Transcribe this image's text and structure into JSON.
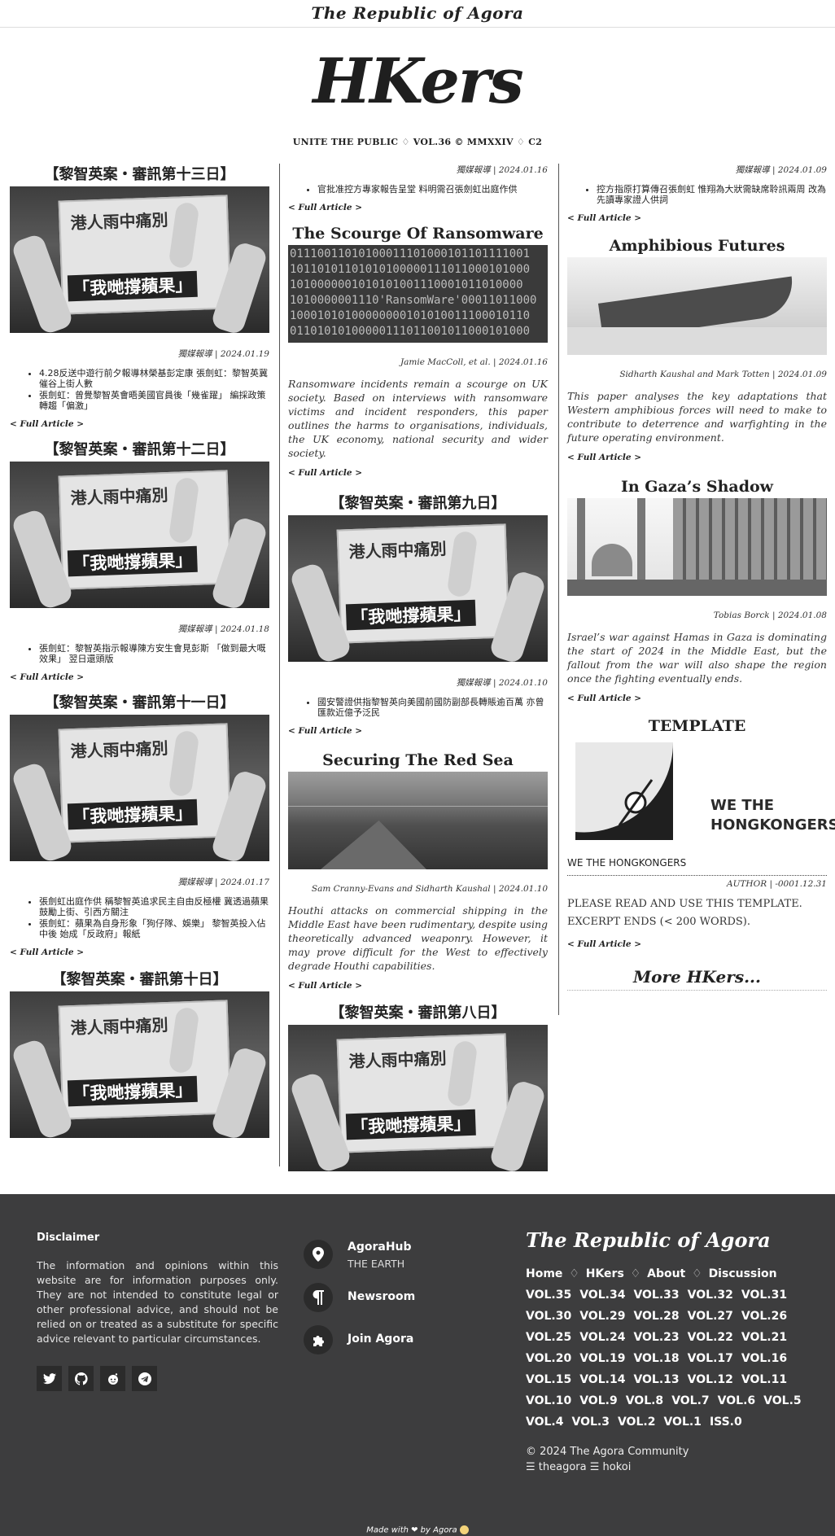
{
  "topbar": {
    "brand": "The Republic of Agora"
  },
  "masthead": {
    "logo": "HKers",
    "tagline": "UNITE THE PUBLIC ♢ VOL.36 © MMXXIV ♢ C2"
  },
  "full_article": "< Full Article >",
  "photo_text": {
    "headline": "港人雨中痛別",
    "slogan": "「我哋撐蘋果」"
  },
  "left": [
    {
      "title": "【黎智英案・審訊第十三日】",
      "byline": "獨媒報導 | 2024.01.19",
      "bullets": [
        "4.28反送中遊行前夕報導林榮基彭定康 張劍虹：黎智英冀催谷上街人數",
        "張劍虹：曾覺黎智英會晤美國官員後「幾雀躍」 編採政策轉趨「偏激」"
      ]
    },
    {
      "title": "【黎智英案・審訊第十二日】",
      "byline": "獨媒報導 | 2024.01.18",
      "bullets": [
        "張劍虹：黎智英指示報導陳方安生會見彭斯 「做到最大嘅效果」 翌日還頭版"
      ]
    },
    {
      "title": "【黎智英案・審訊第十一日】",
      "byline": "獨媒報導 | 2024.01.17",
      "bullets": [
        "張劍虹出庭作供 稱黎智英追求民主自由反極權 冀透過蘋果鼓勵上街、引西方關注",
        "張劍虹：蘋果為自身形象「狗仔隊、娛樂」 黎智英投入佔中後 始成「反政府」報紙"
      ]
    },
    {
      "title": "【黎智英案・審訊第十日】"
    }
  ],
  "mid": {
    "top": {
      "byline": "獨媒報導 | 2024.01.16",
      "bullets": [
        "官批准控方專家報告呈堂 料明需召張劍虹出庭作供"
      ]
    },
    "ransom": {
      "title": "The Scourge Of Ransomware",
      "byline": "Jamie MacColl, et al. | 2024.01.16",
      "abstract": "Ransomware incidents remain a scourge on UK society. Based on interviews with ransomware victims and incident responders, this paper outlines the harms to organisations, individuals, the UK economy, national security and wider society.",
      "code": [
        "01110011010100011101000101101111001",
        "10110101101010100000111011000101000",
        "1010000001010101001110001011010000",
        "1010000001110'RansomWare'00011011000",
        "10001010100000000101010011100010110",
        "01101010100000111011001011000101000"
      ]
    },
    "day9": {
      "title": "【黎智英案・審訊第九日】",
      "byline": "獨媒報導 | 2024.01.10",
      "bullets": [
        "國安警證供指黎智英向美國前國防副部長轉賬逾百萬 亦曾匯款近億予泛民"
      ]
    },
    "redsea": {
      "title": "Securing The Red Sea",
      "byline": "Sam Cranny-Evans and Sidharth Kaushal | 2024.01.10",
      "abstract": "Houthi attacks on commercial shipping in the Middle East have been rudimentary, despite using theoretically advanced weaponry. However, it may prove difficult for the West to effectively degrade Houthi capabilities."
    },
    "day8": {
      "title": "【黎智英案・審訊第八日】"
    }
  },
  "right": {
    "top": {
      "byline": "獨媒報導 | 2024.01.09",
      "bullets": [
        "控方指原打算傳召張劍虹 惟翔為大狀需缺席聆訊兩周 改為先讀專家證人供詞"
      ]
    },
    "amphib": {
      "title": "Amphibious Futures",
      "byline": "Sidharth Kaushal and Mark Totten | 2024.01.09",
      "abstract": "This paper analyses the key adaptations that Western amphibious forces will need to make to contribute to deterrence and warfighting in the future operating environment."
    },
    "gaza": {
      "title": "In Gaza’s Shadow",
      "byline": "Tobias Borck | 2024.01.08",
      "abstract": "Israel’s war against Hamas in Gaza is dominating the start of 2024 in the Middle East, but the fallout from the war will also shape the region once the fighting eventually ends."
    },
    "template": {
      "title": "TEMPLATE",
      "logo_line1": "WE THE",
      "logo_line2": "HONGKONGERS",
      "caption": "WE THE HONGKONGERS",
      "byline": "AUTHOR | -0001.12.31",
      "body1": "PLEASE READ AND USE THIS TEMPLATE.",
      "body2": "EXCERPT ENDS (< 200 WORDS)."
    },
    "more": "More HKers..."
  },
  "footer": {
    "disclaimer_title": "Disclaimer",
    "disclaimer": "The information and opinions within this website are for information purposes only. They are not intended to constitute legal or other professional advice, and should not be relied on or treated as a substitute for specific advice relevant to particular circumstances.",
    "socials": [
      "twitter-icon",
      "github-icon",
      "reddit-icon",
      "telegram-icon"
    ],
    "links": [
      {
        "title": "AgoraHub",
        "sub": "THE EARTH",
        "icon": "location-pin-icon"
      },
      {
        "title": "Newsroom",
        "icon": "pilcrow-icon"
      },
      {
        "title": "Join Agora",
        "icon": "puzzle-icon"
      }
    ],
    "brand": "The Republic of Agora",
    "nav": [
      "Home",
      "HKers",
      "About",
      "Discussion"
    ],
    "nav_sep": "♢",
    "vols": [
      "VOL.35",
      "VOL.34",
      "VOL.33",
      "VOL.32",
      "VOL.31",
      "VOL.30",
      "VOL.29",
      "VOL.28",
      "VOL.27",
      "VOL.26",
      "VOL.25",
      "VOL.24",
      "VOL.23",
      "VOL.22",
      "VOL.21",
      "VOL.20",
      "VOL.19",
      "VOL.18",
      "VOL.17",
      "VOL.16",
      "VOL.15",
      "VOL.14",
      "VOL.13",
      "VOL.12",
      "VOL.11",
      "VOL.10",
      "VOL.9",
      "VOL.8",
      "VOL.7",
      "VOL.6",
      "VOL.5",
      "VOL.4",
      "VOL.3",
      "VOL.2",
      "VOL.1",
      "ISS.0"
    ],
    "copyright": "© 2024 The Agora Community",
    "handle1": "☰ theagora",
    "handle2": "☰ hokoi",
    "made_with": "Made with ❤ by Agora"
  }
}
